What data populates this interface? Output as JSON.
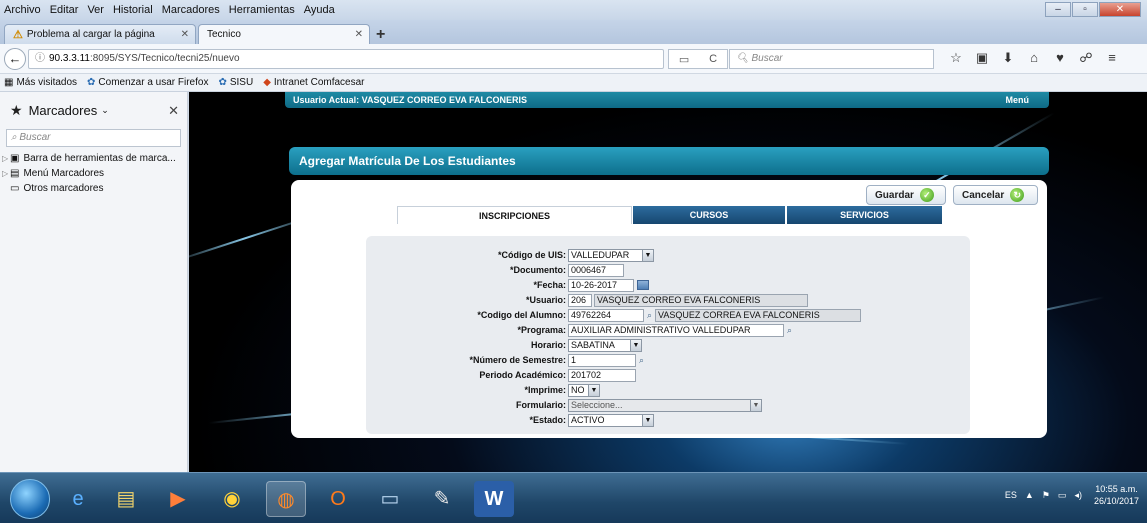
{
  "menubar": {
    "items": [
      "Archivo",
      "Editar",
      "Ver",
      "Historial",
      "Marcadores",
      "Herramientas",
      "Ayuda"
    ],
    "window_controls": [
      "–",
      "▫",
      "✕"
    ]
  },
  "tabs": [
    {
      "label": "Problema al cargar la página",
      "icon": "warning-icon"
    },
    {
      "label": "Tecnico",
      "icon": ""
    }
  ],
  "new_tab_label": "+",
  "navigation": {
    "back_icon": "←",
    "url_host": "90.3.3.11",
    "url_path": ":8095/SYS/Tecnico/tecni25/nuevo",
    "info_icon": "ⓘ",
    "url_tools": [
      "▭",
      "C"
    ],
    "search_placeholder": "Buscar",
    "icons": [
      "☆",
      "▣",
      "⬇",
      "⌂",
      "♥",
      "☍",
      "≡"
    ]
  },
  "bookmarks_bar": [
    {
      "icon": "▦",
      "label": "Más visitados"
    },
    {
      "icon": "✿",
      "label": "Comenzar a usar Firefox"
    },
    {
      "icon": "✿",
      "label": "SISU"
    },
    {
      "icon": "◆",
      "label": "Intranet Comfacesar"
    }
  ],
  "sidebar": {
    "title": "Marcadores",
    "search_placeholder": "Buscar",
    "items": [
      {
        "label": "Barra de herramientas de marca...",
        "icon": "▣",
        "expandable": true
      },
      {
        "label": "Menú Marcadores",
        "icon": "▤",
        "expandable": true
      },
      {
        "label": "Otros marcadores",
        "icon": "▭",
        "expandable": false
      }
    ]
  },
  "app": {
    "user_label": "Usuario Actual: VASQUEZ CORREO EVA FALCONERIS",
    "menu_label": "Menú",
    "page_title": "Agregar Matrícula De Los Estudiantes",
    "save_label": "Guardar",
    "cancel_label": "Cancelar",
    "form_tabs": [
      "INSCRIPCIONES",
      "CURSOS",
      "SERVICIOS"
    ],
    "fields": {
      "codigo_uis": {
        "label": "*Código de UIS:",
        "value": "VALLEDUPAR"
      },
      "documento": {
        "label": "*Documento:",
        "value": "0006467"
      },
      "fecha": {
        "label": "*Fecha:",
        "value": "10-26-2017"
      },
      "usuario": {
        "label": "*Usuario:",
        "code": "206",
        "name": "VASQUEZ CORREO EVA FALCONERIS"
      },
      "codigo_alumno": {
        "label": "*Codigo del Alumno:",
        "code": "49762264",
        "name": "VASQUEZ CORREA EVA FALCONERIS"
      },
      "programa": {
        "label": "*Programa:",
        "value": "AUXILIAR ADMINISTRATIVO VALLEDUPAR"
      },
      "horario": {
        "label": "Horario:",
        "value": "SABATINA"
      },
      "semestre": {
        "label": "*Número de Semestre:",
        "value": "1"
      },
      "periodo": {
        "label": "Periodo Académico:",
        "value": "201702"
      },
      "imprime": {
        "label": "*Imprime:",
        "value": "NO"
      },
      "formulario": {
        "label": "Formulario:",
        "value": "Seleccione..."
      },
      "estado": {
        "label": "*Estado:",
        "value": "ACTIVO"
      }
    }
  },
  "taskbar": {
    "apps": [
      "e",
      "▤",
      "▶",
      "◉",
      "◍",
      "O",
      "▭",
      "✎",
      "W"
    ],
    "tray": {
      "lang": "ES",
      "time": "10:55 a.m.",
      "date": "26/10/2017"
    }
  },
  "colors": {
    "accent": "#1e8aa4",
    "tab_dark": "#16466f",
    "taskbar": "#1f4668"
  }
}
